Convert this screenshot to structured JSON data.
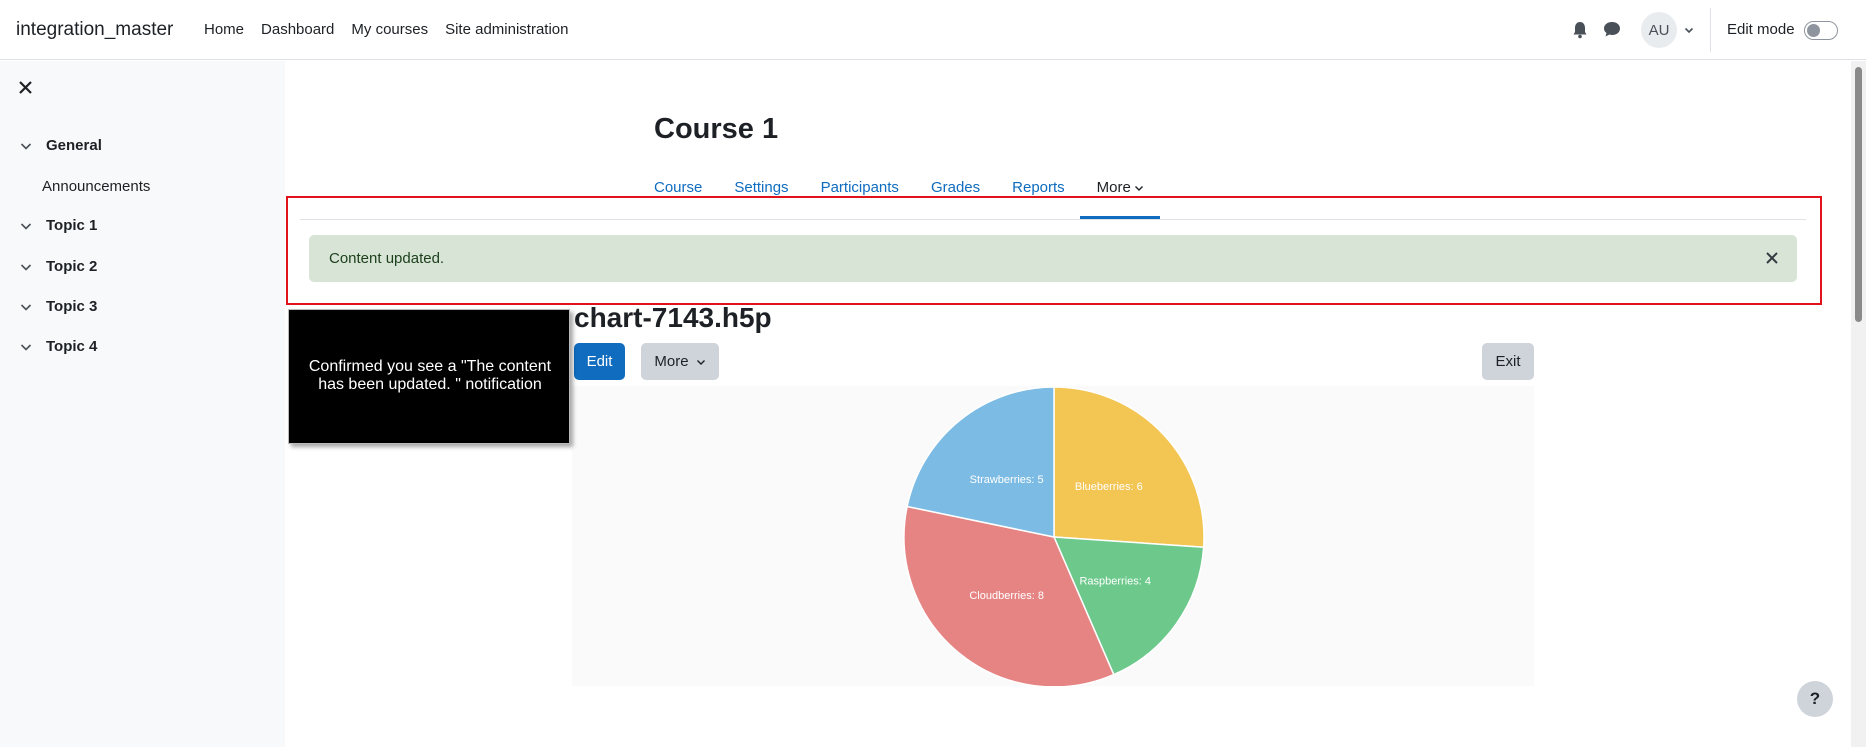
{
  "navbar": {
    "brand": "integration_master",
    "links": [
      "Home",
      "Dashboard",
      "My courses",
      "Site administration"
    ],
    "avatar_initials": "AU",
    "edit_mode_label": "Edit mode",
    "edit_mode_on": false
  },
  "drawer": {
    "items": [
      {
        "label": "General",
        "expanded": true
      },
      {
        "label": "Announcements"
      },
      {
        "label": "Topic 1",
        "expanded": true
      },
      {
        "label": "Topic 2",
        "expanded": true
      },
      {
        "label": "Topic 3",
        "expanded": true
      },
      {
        "label": "Topic 4",
        "expanded": true
      }
    ]
  },
  "course": {
    "title": "Course 1",
    "tabs": [
      "Course",
      "Settings",
      "Participants",
      "Grades",
      "Reports",
      "More"
    ],
    "active_tab": "More"
  },
  "alert": {
    "message": "Content updated."
  },
  "h5p": {
    "title": "chart-7143.h5p",
    "edit_label": "Edit",
    "more_label": "More",
    "exit_label": "Exit"
  },
  "chart_data": {
    "type": "pie",
    "slices": [
      {
        "label": "Blueberries: 6",
        "name": "Blueberries",
        "value": 6,
        "color": "#f3c553"
      },
      {
        "label": "Raspberries: 4",
        "name": "Raspberries",
        "value": 4,
        "color": "#6cc98b"
      },
      {
        "label": "Cloudberries: 8",
        "name": "Cloudberries",
        "value": 8,
        "color": "#e68484"
      },
      {
        "label": "Strawberries: 5",
        "name": "Strawberries",
        "value": 5,
        "color": "#7cbbe3"
      }
    ]
  },
  "tooltip": {
    "text": "Confirmed you see a  \"The content has been updated. \" notification"
  },
  "help": {
    "label": "?"
  },
  "colors": {
    "link": "#0f6cbf",
    "alert_bg": "#d7e4d6",
    "highlight": "#e0121a"
  }
}
